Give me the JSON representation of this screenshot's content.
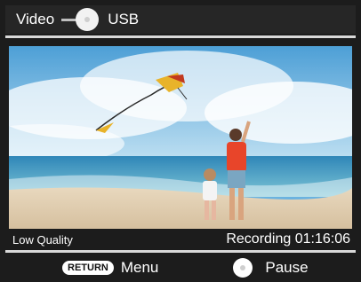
{
  "header": {
    "source_label": "Video",
    "target_label": "USB",
    "arrow_icon": "arrow-right-icon"
  },
  "status": {
    "quality": "Low Quality",
    "recording": "Recording 01:16:06"
  },
  "footer": {
    "return_key": "RETURN",
    "menu_label": "Menu",
    "pause_label": "Pause",
    "pause_icon": "circle-button-icon"
  },
  "colors": {
    "background": "#1c1c1c",
    "separator": "#d9d9d9",
    "text": "#ffffff"
  }
}
